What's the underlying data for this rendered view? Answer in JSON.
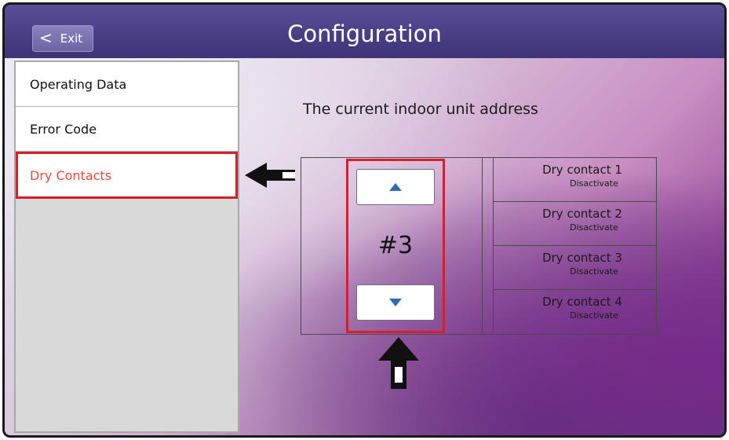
{
  "header": {
    "exit_label": "Exit",
    "title": "Configuration"
  },
  "sidebar": {
    "items": [
      {
        "label": "Operating Data",
        "selected": false
      },
      {
        "label": "Error Code",
        "selected": false
      },
      {
        "label": "Dry Contacts",
        "selected": true
      }
    ]
  },
  "main": {
    "heading": "The current indoor unit address",
    "address": "#3",
    "dry_contacts": [
      {
        "name": "Dry contact 1",
        "status": "Disactivate"
      },
      {
        "name": "Dry contact 2",
        "status": "Disactivate"
      },
      {
        "name": "Dry contact 3",
        "status": "Disactivate"
      },
      {
        "name": "Dry contact 4",
        "status": "Disactivate"
      }
    ]
  },
  "icons": {
    "exit": "chevron-left-icon",
    "increase": "triangle-up-icon",
    "decrease": "triangle-down-icon",
    "callouts": [
      "arrow-left-icon",
      "arrow-up-icon"
    ]
  },
  "colors": {
    "titlebar": "#4a3f86",
    "highlight": "#d71f29",
    "selected_text": "#e64a3a",
    "arrow_button_icon": "#2f6bb3"
  }
}
